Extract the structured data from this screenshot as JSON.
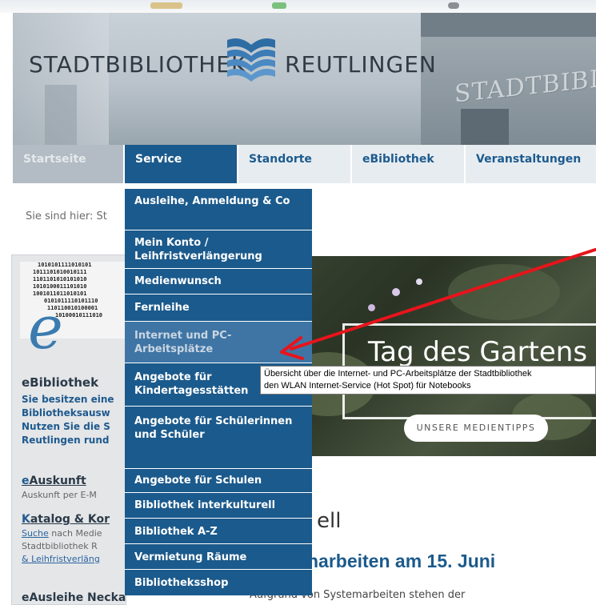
{
  "header": {
    "logo_left": "STADTBIBLIOTHEK",
    "logo_right": "REUTLINGEN",
    "facade_text": "STADTBIBLIOTH"
  },
  "nav": {
    "items": [
      {
        "label": "Startseite"
      },
      {
        "label": "Service"
      },
      {
        "label": "Standorte"
      },
      {
        "label": "eBibliothek"
      },
      {
        "label": "Veranstaltungen"
      }
    ]
  },
  "breadcrumb": {
    "text": "Sie sind hier: St"
  },
  "sidebar": {
    "ebib_title": "eBibliothek",
    "ebib_text": "Sie besitzen eine\nBibliotheksausw\nNutzen Sie die S\nReutlingen rund",
    "auskunft_title_cap": "e",
    "auskunft_title_rest": "Auskunft",
    "auskunft_text": "Auskunft per E-M",
    "katalog_title_cap": "K",
    "katalog_title_rest": "atalog & Kor",
    "katalog_line1_link": "Suche",
    "katalog_line1_rest": " nach Medie",
    "katalog_line2": "Stadtbibliothek R",
    "katalog_line3_link": "& Leihfristverläng",
    "ausleihe_title": "eAusleihe Neckar-Alb"
  },
  "dropdown": {
    "items": [
      {
        "label": "Ausleihe, Anmeldung & Co"
      },
      {
        "label": "Mein Konto / Leihfristverlängerung"
      },
      {
        "label": "Medienwunsch"
      },
      {
        "label": "Fernleihe"
      },
      {
        "label": "Internet und PC-Arbeitsplätze"
      },
      {
        "label": "Angebote für Kindertagesstätten"
      },
      {
        "label": "Angebote für Schülerinnen und Schüler"
      },
      {
        "label": "Angebote für Schulen"
      },
      {
        "label": "Bibliothek interkulturell"
      },
      {
        "label": "Bibliothek A-Z"
      },
      {
        "label": "Vermietung Räume"
      },
      {
        "label": "Bibliotheksshop"
      }
    ]
  },
  "tooltip": {
    "line1": "Übersicht über die Internet- und PC-Arbeitsplätze der Stadtbibliothek",
    "line2": "den WLAN Internet-Service (Hot Spot) für Notebooks"
  },
  "promo": {
    "title": "Tag des Gartens",
    "button": "UNSERE MEDIENTIPPS"
  },
  "main": {
    "title_fragment": "ell",
    "subtitle_fragment": "narbeiten am 15. Juni",
    "text_fragment": "Aufgrund von Systemarbeiten stehen der"
  },
  "colors": {
    "nav_active": "#1b5a8c",
    "dropdown_bg": "#1b5a8c",
    "dropdown_hover": "#3f75a5",
    "link_blue": "#1f5a8e",
    "annotation_red": "#e8141b"
  }
}
